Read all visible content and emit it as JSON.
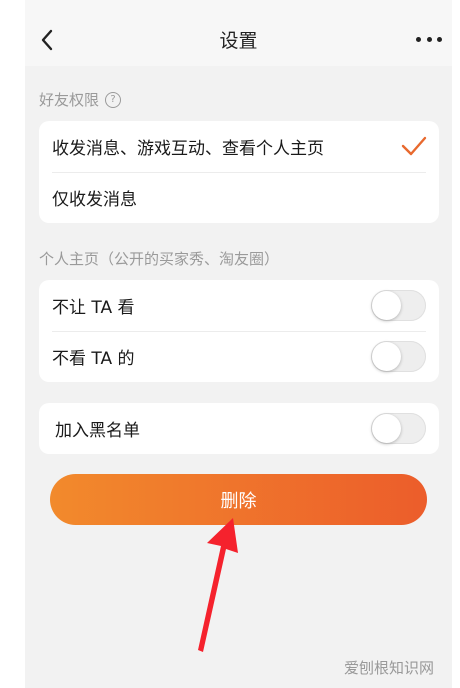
{
  "navbar": {
    "title": "设置",
    "back_icon": "chevron-left-icon",
    "more_icon": "more-horizontal-icon"
  },
  "friend_permission": {
    "label": "好友权限",
    "help_glyph": "?",
    "options": [
      {
        "label": "收发消息、游戏互动、查看个人主页",
        "selected": true
      },
      {
        "label": "仅收发消息",
        "selected": false
      }
    ]
  },
  "homepage": {
    "label": "个人主页（公开的买家秀、淘友圈）",
    "items": [
      {
        "label": "不让 TA 看",
        "on": false
      },
      {
        "label": "不看 TA 的",
        "on": false
      }
    ]
  },
  "blacklist": {
    "label": "加入黑名单",
    "on": false
  },
  "delete_button": {
    "label": "删除"
  },
  "watermark": "爱刨根知识网",
  "colors": {
    "accent": "#ec6b2b",
    "check": "#e8692e",
    "gradient_start": "#f28a2c",
    "gradient_end": "#ec5d2b",
    "annotation_arrow": "#f5222d"
  }
}
